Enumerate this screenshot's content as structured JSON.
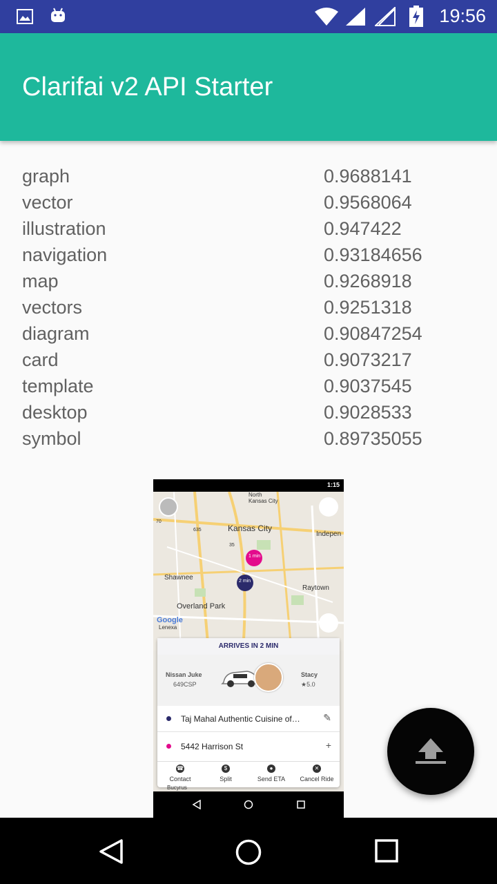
{
  "status_bar": {
    "time": "19:56",
    "icons": [
      "image-icon",
      "android-icon",
      "wifi-icon",
      "signal-icon",
      "signal-empty-icon",
      "battery-charging-icon"
    ]
  },
  "app_bar": {
    "title": "Clarifai v2 API Starter"
  },
  "results": [
    {
      "label": "graph",
      "value": "0.9688141"
    },
    {
      "label": "vector",
      "value": "0.9568064"
    },
    {
      "label": "illustration",
      "value": "0.947422"
    },
    {
      "label": "navigation",
      "value": "0.93184656"
    },
    {
      "label": "map",
      "value": "0.9268918"
    },
    {
      "label": "vectors",
      "value": "0.9251318"
    },
    {
      "label": "diagram",
      "value": "0.90847254"
    },
    {
      "label": "card",
      "value": "0.9073217"
    },
    {
      "label": "template",
      "value": "0.9037545"
    },
    {
      "label": "desktop",
      "value": "0.9028533"
    },
    {
      "label": "symbol",
      "value": "0.89735055"
    }
  ],
  "preview": {
    "status_time": "1:15",
    "map_labels": {
      "north": "North",
      "kansas_city_small": "Kansas City",
      "kansas_city": "Kansas City",
      "independence": "Indepen",
      "shawnee": "Shawnee",
      "raytown": "Raytown",
      "overland_park": "Overland Park",
      "lenexa": "Lenexa",
      "google": "Google",
      "bucyrus": "Bucyrus",
      "hw_635": "635",
      "hw_35": "35",
      "hw_70": "70",
      "pin_a": "1 min",
      "pin_b": "2 min"
    },
    "arrives": "ARRIVES IN 2 MIN",
    "car_model": "Nissan Juke",
    "plate": "649CSP",
    "driver_name": "Stacy",
    "rating": "★5.0",
    "pickup": "Taj Mahal Authentic Cuisine of…",
    "destination": "5442 Harrison St",
    "actions": [
      "Contact",
      "Split",
      "Send ETA",
      "Cancel Ride"
    ]
  },
  "fab": {
    "icon": "upload-icon"
  },
  "nav_bar": {
    "icons": [
      "back-icon",
      "home-icon",
      "recents-icon"
    ]
  }
}
